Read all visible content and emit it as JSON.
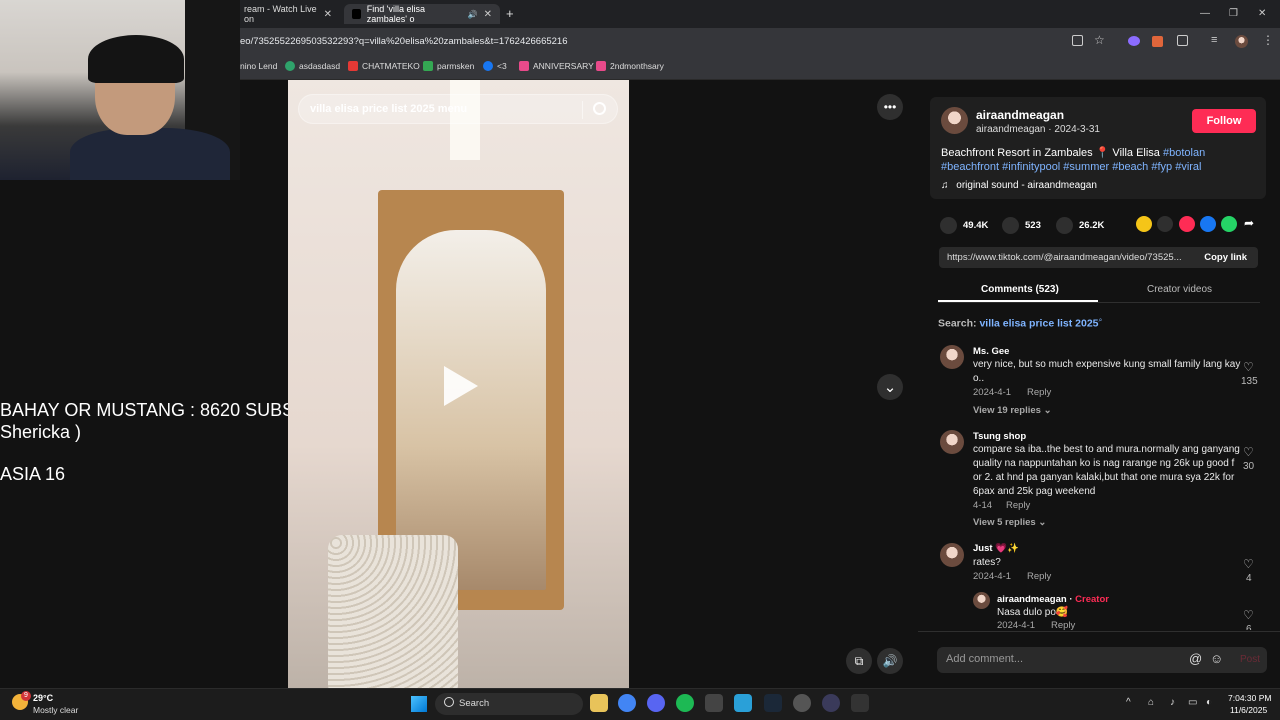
{
  "browser": {
    "tabs": [
      {
        "label": "ream - Watch Live on"
      },
      {
        "label": "Find 'villa elisa zambales' o"
      }
    ],
    "url": "eo/7352552269503532293?q=villa%20elisa%20zambales&t=1762426665216",
    "bookmarks": [
      "nino Lend",
      "asdasdasd",
      "CHATMATEKO",
      "parmsken",
      "<3",
      "ANNIVERSARY",
      "2ndmonthsary"
    ],
    "window_controls": {
      "minimize": "—",
      "restore": "❐",
      "close": "✕"
    }
  },
  "overlay": {
    "line1": "BAHAY OR MUSTANG : 8620 SUBS",
    "line2": "Shericka )",
    "line3": "ASIA 16"
  },
  "video": {
    "search_placeholder": "villa elisa price list 2025 menu",
    "more_label": "•••",
    "down_label": "⌄",
    "mute_label": "🔊",
    "pip_label": "⧉"
  },
  "post": {
    "username": "airaandmeagan",
    "meta": "airaandmeagan · 2024-3-31",
    "follow_label": "Follow",
    "caption_plain": "Beachfront Resort in Zambales 📍 Villa Elisa ",
    "tags_line1": "#botolan",
    "tags_line2": "#beachfront #infinitypool #summer #beach #fyp #viral",
    "sound": "original sound - airaandmeagan",
    "likes": "49.4K",
    "comments": "523",
    "saves": "26.2K",
    "link": "https://www.tiktok.com/@airaandmeagan/video/73525...",
    "copy_label": "Copy link"
  },
  "panel_tabs": {
    "comments": "Comments (523)",
    "creator": "Creator videos"
  },
  "search_line": {
    "prefix": "Search: ",
    "query": "villa elisa price list 2025"
  },
  "comments": [
    {
      "name": "Ms. Gee",
      "text1": "very nice, but so much expensive kung small family lang kay",
      "text2": "o..",
      "date": "2024-4-1",
      "reply": "Reply",
      "likes": "135",
      "view": "View 19 replies"
    },
    {
      "name": "Tsung shop",
      "text1": "compare sa iba..the best to and mura.normally ang ganyang",
      "text2": "quality na nappuntahan ko is nag rarange ng 26k up good f",
      "text3": "or 2. at hnd pa ganyan kalaki,but that one mura sya 22k for",
      "text4": "6pax and 25k pag weekend",
      "date": "4-14",
      "reply": "Reply",
      "likes": "30",
      "view": "View 5 replies"
    },
    {
      "name": "Just 💗✨",
      "text1": "rates?",
      "date": "2024-4-1",
      "reply": "Reply",
      "likes": "4"
    }
  ],
  "reply": {
    "name": "airaandmeagan",
    "creator": "Creator",
    "text": "Nasa dulo po🥰",
    "date": "2024-4-1",
    "reply": "Reply",
    "likes": "6"
  },
  "comment_input": {
    "placeholder": "Add comment...",
    "post": "Post"
  },
  "taskbar": {
    "weather_temp": "29°C",
    "weather_desc": "Mostly clear",
    "search_label": "Search",
    "time": "7:04:30 PM",
    "date": "11/6/2025",
    "badge_weather": "9"
  }
}
